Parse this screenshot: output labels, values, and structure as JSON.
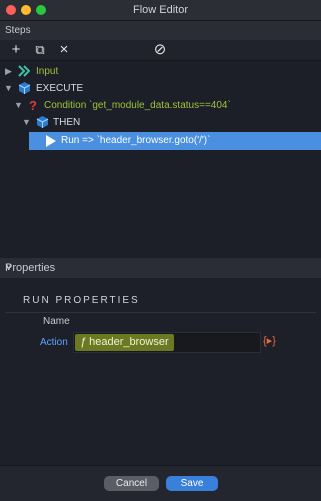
{
  "window": {
    "title": "Flow Editor"
  },
  "steps": {
    "header": "Steps",
    "toolbar": {
      "add": "+",
      "copy": "⧉",
      "remove": "×",
      "disable": "⊘"
    }
  },
  "tree": [
    {
      "label": "Input",
      "color": "#9bc43a",
      "icon": "chevrons-right-icon"
    },
    {
      "label": "EXECUTE",
      "color": "#d8dbe2",
      "icon": "cube-icon"
    },
    {
      "label": "Condition `get_module_data.status==404`",
      "color": "#9bc43a",
      "icon": "question-icon"
    },
    {
      "label": "THEN",
      "color": "#d8dbe2",
      "icon": "cube-icon"
    },
    {
      "label": "Run => `header_browser.goto('/')`",
      "color": "#ffffff",
      "icon": "play-icon",
      "selected": true
    }
  ],
  "properties": {
    "header": "Properties",
    "section_title": "RUN PROPERTIES",
    "name_label": "Name",
    "action_label": "Action",
    "action_value": "header_browser",
    "action_func_symbol": "ƒ",
    "dynamic_icon": "{▸}"
  },
  "footer": {
    "cancel_label": "Cancel",
    "save_label": "Save"
  },
  "colors": {
    "accent": "#4a8fe0",
    "save": "#3a7fd9",
    "expression": "#6b7a22"
  }
}
